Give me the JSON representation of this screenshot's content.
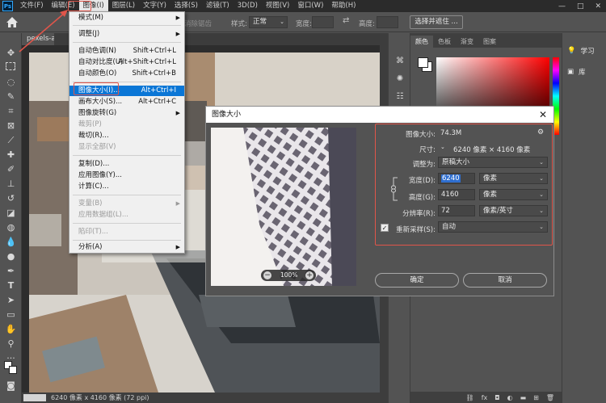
{
  "menubar": {
    "logo": "Ps",
    "items": [
      "文件(F)",
      "编辑(E)",
      "图像(I)",
      "图层(L)",
      "文字(Y)",
      "选择(S)",
      "滤镜(T)",
      "3D(D)",
      "视图(V)",
      "窗口(W)",
      "帮助(H)"
    ],
    "active_index": 2,
    "window_controls": [
      "—",
      "□",
      "✕"
    ]
  },
  "options_bar": {
    "antialias_label": "消除锯齿",
    "style_label": "样式:",
    "style_value": "正常",
    "width_label": "宽度:",
    "height_label": "高度:",
    "select_subject_button": "选择并遮住 ..."
  },
  "document": {
    "tab_title": "pexels-adam-s",
    "tab_close": "×",
    "status_text": "6240 像素 x 4160 像素 (72 ppi)"
  },
  "image_menu": {
    "items": [
      {
        "label": "模式(M)",
        "shortcut": "",
        "submenu": true,
        "disabled": false
      },
      {
        "label": "调整(J)",
        "shortcut": "",
        "submenu": true,
        "disabled": false
      },
      {
        "label": "自动色调(N)",
        "shortcut": "Shift+Ctrl+L",
        "submenu": false,
        "disabled": false
      },
      {
        "label": "自动对比度(U)",
        "shortcut": "Alt+Shift+Ctrl+L",
        "submenu": false,
        "disabled": false
      },
      {
        "label": "自动颜色(O)",
        "shortcut": "Shift+Ctrl+B",
        "submenu": false,
        "disabled": false
      },
      {
        "label": "图像大小(I)...",
        "shortcut": "Alt+Ctrl+I",
        "submenu": false,
        "disabled": false,
        "highlighted": true
      },
      {
        "label": "画布大小(S)...",
        "shortcut": "Alt+Ctrl+C",
        "submenu": false,
        "disabled": false
      },
      {
        "label": "图像旋转(G)",
        "shortcut": "",
        "submenu": true,
        "disabled": false
      },
      {
        "label": "裁剪(P)",
        "shortcut": "",
        "submenu": false,
        "disabled": true
      },
      {
        "label": "裁切(R)...",
        "shortcut": "",
        "submenu": false,
        "disabled": false
      },
      {
        "label": "显示全部(V)",
        "shortcut": "",
        "submenu": false,
        "disabled": true
      },
      {
        "label": "复制(D)...",
        "shortcut": "",
        "submenu": false,
        "disabled": false
      },
      {
        "label": "应用图像(Y)...",
        "shortcut": "",
        "submenu": false,
        "disabled": false
      },
      {
        "label": "计算(C)...",
        "shortcut": "",
        "submenu": false,
        "disabled": false
      },
      {
        "label": "变量(B)",
        "shortcut": "",
        "submenu": true,
        "disabled": true
      },
      {
        "label": "应用数据组(L)...",
        "shortcut": "",
        "submenu": false,
        "disabled": true
      },
      {
        "label": "陷印(T)...",
        "shortcut": "",
        "submenu": false,
        "disabled": true
      },
      {
        "label": "分析(A)",
        "shortcut": "",
        "submenu": true,
        "disabled": false
      }
    ]
  },
  "color_panel": {
    "tabs": [
      "颜色",
      "色板",
      "渐变",
      "图案"
    ],
    "active_tab": 0
  },
  "learn_panel": {
    "items": [
      "学习",
      "库"
    ]
  },
  "dialog": {
    "title": "图像大小",
    "image_size_label": "图像大小:",
    "image_size_value": "74.3M",
    "dimensions_label": "尺寸:",
    "dimensions_value": "6240 像素 × 4160 像素",
    "fit_label": "调整为:",
    "fit_value": "原稿大小",
    "width_label": "宽度(D):",
    "width_value": "6240",
    "width_unit": "像素",
    "height_label": "高度(G):",
    "height_value": "4160",
    "height_unit": "像素",
    "resolution_label": "分辨率(R):",
    "resolution_value": "72",
    "resolution_unit": "像素/英寸",
    "resample_label": "重新采样(S):",
    "resample_checked": true,
    "resample_value": "自动",
    "zoom_value": "100%",
    "ok_button": "确定",
    "cancel_button": "取消"
  },
  "colors": {
    "accent_highlight": "#0a76d6",
    "annotation_red": "#e0554a",
    "foreground_swatch": "#ffffff",
    "background_swatch": "#ffffff"
  }
}
